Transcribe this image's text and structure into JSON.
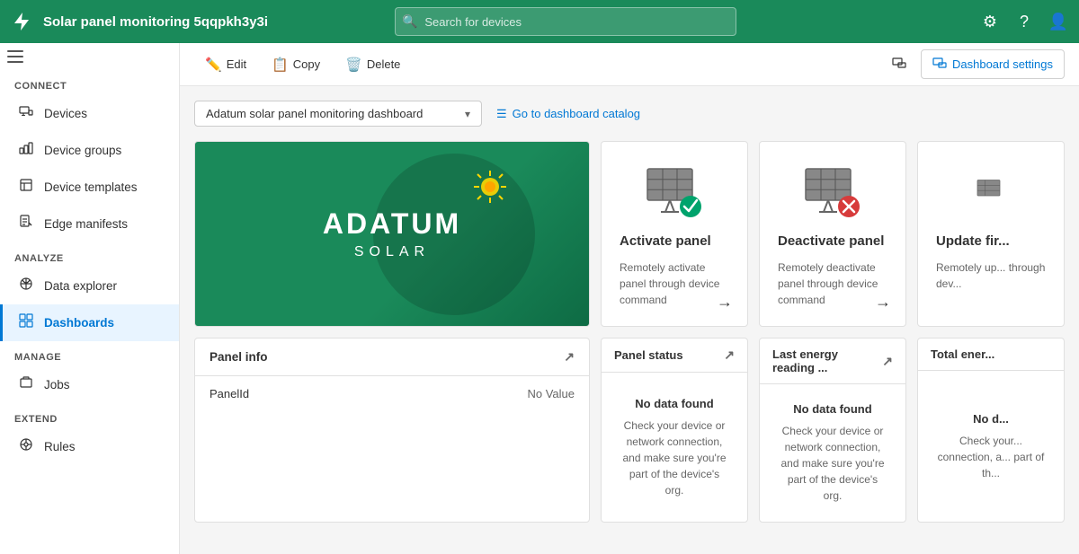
{
  "topbar": {
    "logo_icon": "lightning-icon",
    "title": "Solar panel monitoring 5qqpkh3y3i",
    "search_placeholder": "Search for devices",
    "gear_label": "Settings",
    "help_label": "Help",
    "user_label": "User"
  },
  "sidebar": {
    "connect_label": "Connect",
    "analyze_label": "Analyze",
    "manage_label": "Manage",
    "extend_label": "Extend",
    "items": [
      {
        "id": "devices",
        "label": "Devices",
        "icon": "📱"
      },
      {
        "id": "device-groups",
        "label": "Device groups",
        "icon": "📊"
      },
      {
        "id": "device-templates",
        "label": "Device templates",
        "icon": "🗂"
      },
      {
        "id": "edge-manifests",
        "label": "Edge manifests",
        "icon": "📄"
      },
      {
        "id": "data-explorer",
        "label": "Data explorer",
        "icon": "📈"
      },
      {
        "id": "dashboards",
        "label": "Dashboards",
        "icon": "🔲",
        "active": true
      },
      {
        "id": "jobs",
        "label": "Jobs",
        "icon": "🔧"
      },
      {
        "id": "rules",
        "label": "Rules",
        "icon": "⚙"
      }
    ]
  },
  "toolbar": {
    "edit_label": "Edit",
    "copy_label": "Copy",
    "delete_label": "Delete",
    "dashboard_settings_label": "Dashboard settings"
  },
  "dashboard": {
    "dropdown_value": "Adatum solar panel monitoring dashboard",
    "catalog_link": "Go to dashboard catalog",
    "hero": {
      "brand": "ADATUM",
      "sub": "SOLAR"
    },
    "cards": [
      {
        "id": "activate-panel",
        "title": "Activate panel",
        "description": "Remotely activate panel through device command",
        "type": "command"
      },
      {
        "id": "deactivate-panel",
        "title": "Deactivate panel",
        "description": "Remotely deactivate panel through device command",
        "type": "command"
      },
      {
        "id": "update-firmware",
        "title": "Update fir...",
        "description": "Remotely up... through dev...",
        "type": "command-partial"
      }
    ],
    "status_cards": [
      {
        "id": "panel-info",
        "title": "Panel info",
        "type": "info",
        "fields": [
          {
            "label": "PanelId",
            "value": "No Value"
          }
        ]
      },
      {
        "id": "panel-status",
        "title": "Panel status",
        "type": "status",
        "no_data_title": "No data found",
        "no_data_desc": "Check your device or network connection, and make sure you're part of the device's org."
      },
      {
        "id": "last-energy-reading",
        "title": "Last energy reading ...",
        "type": "status",
        "no_data_title": "No data found",
        "no_data_desc": "Check your device or network connection, and make sure you're part of the device's org."
      },
      {
        "id": "total-energy",
        "title": "Total ener...",
        "type": "status-partial",
        "no_data_title": "No d...",
        "no_data_desc": "Check your... connection, a... part of th..."
      }
    ]
  }
}
